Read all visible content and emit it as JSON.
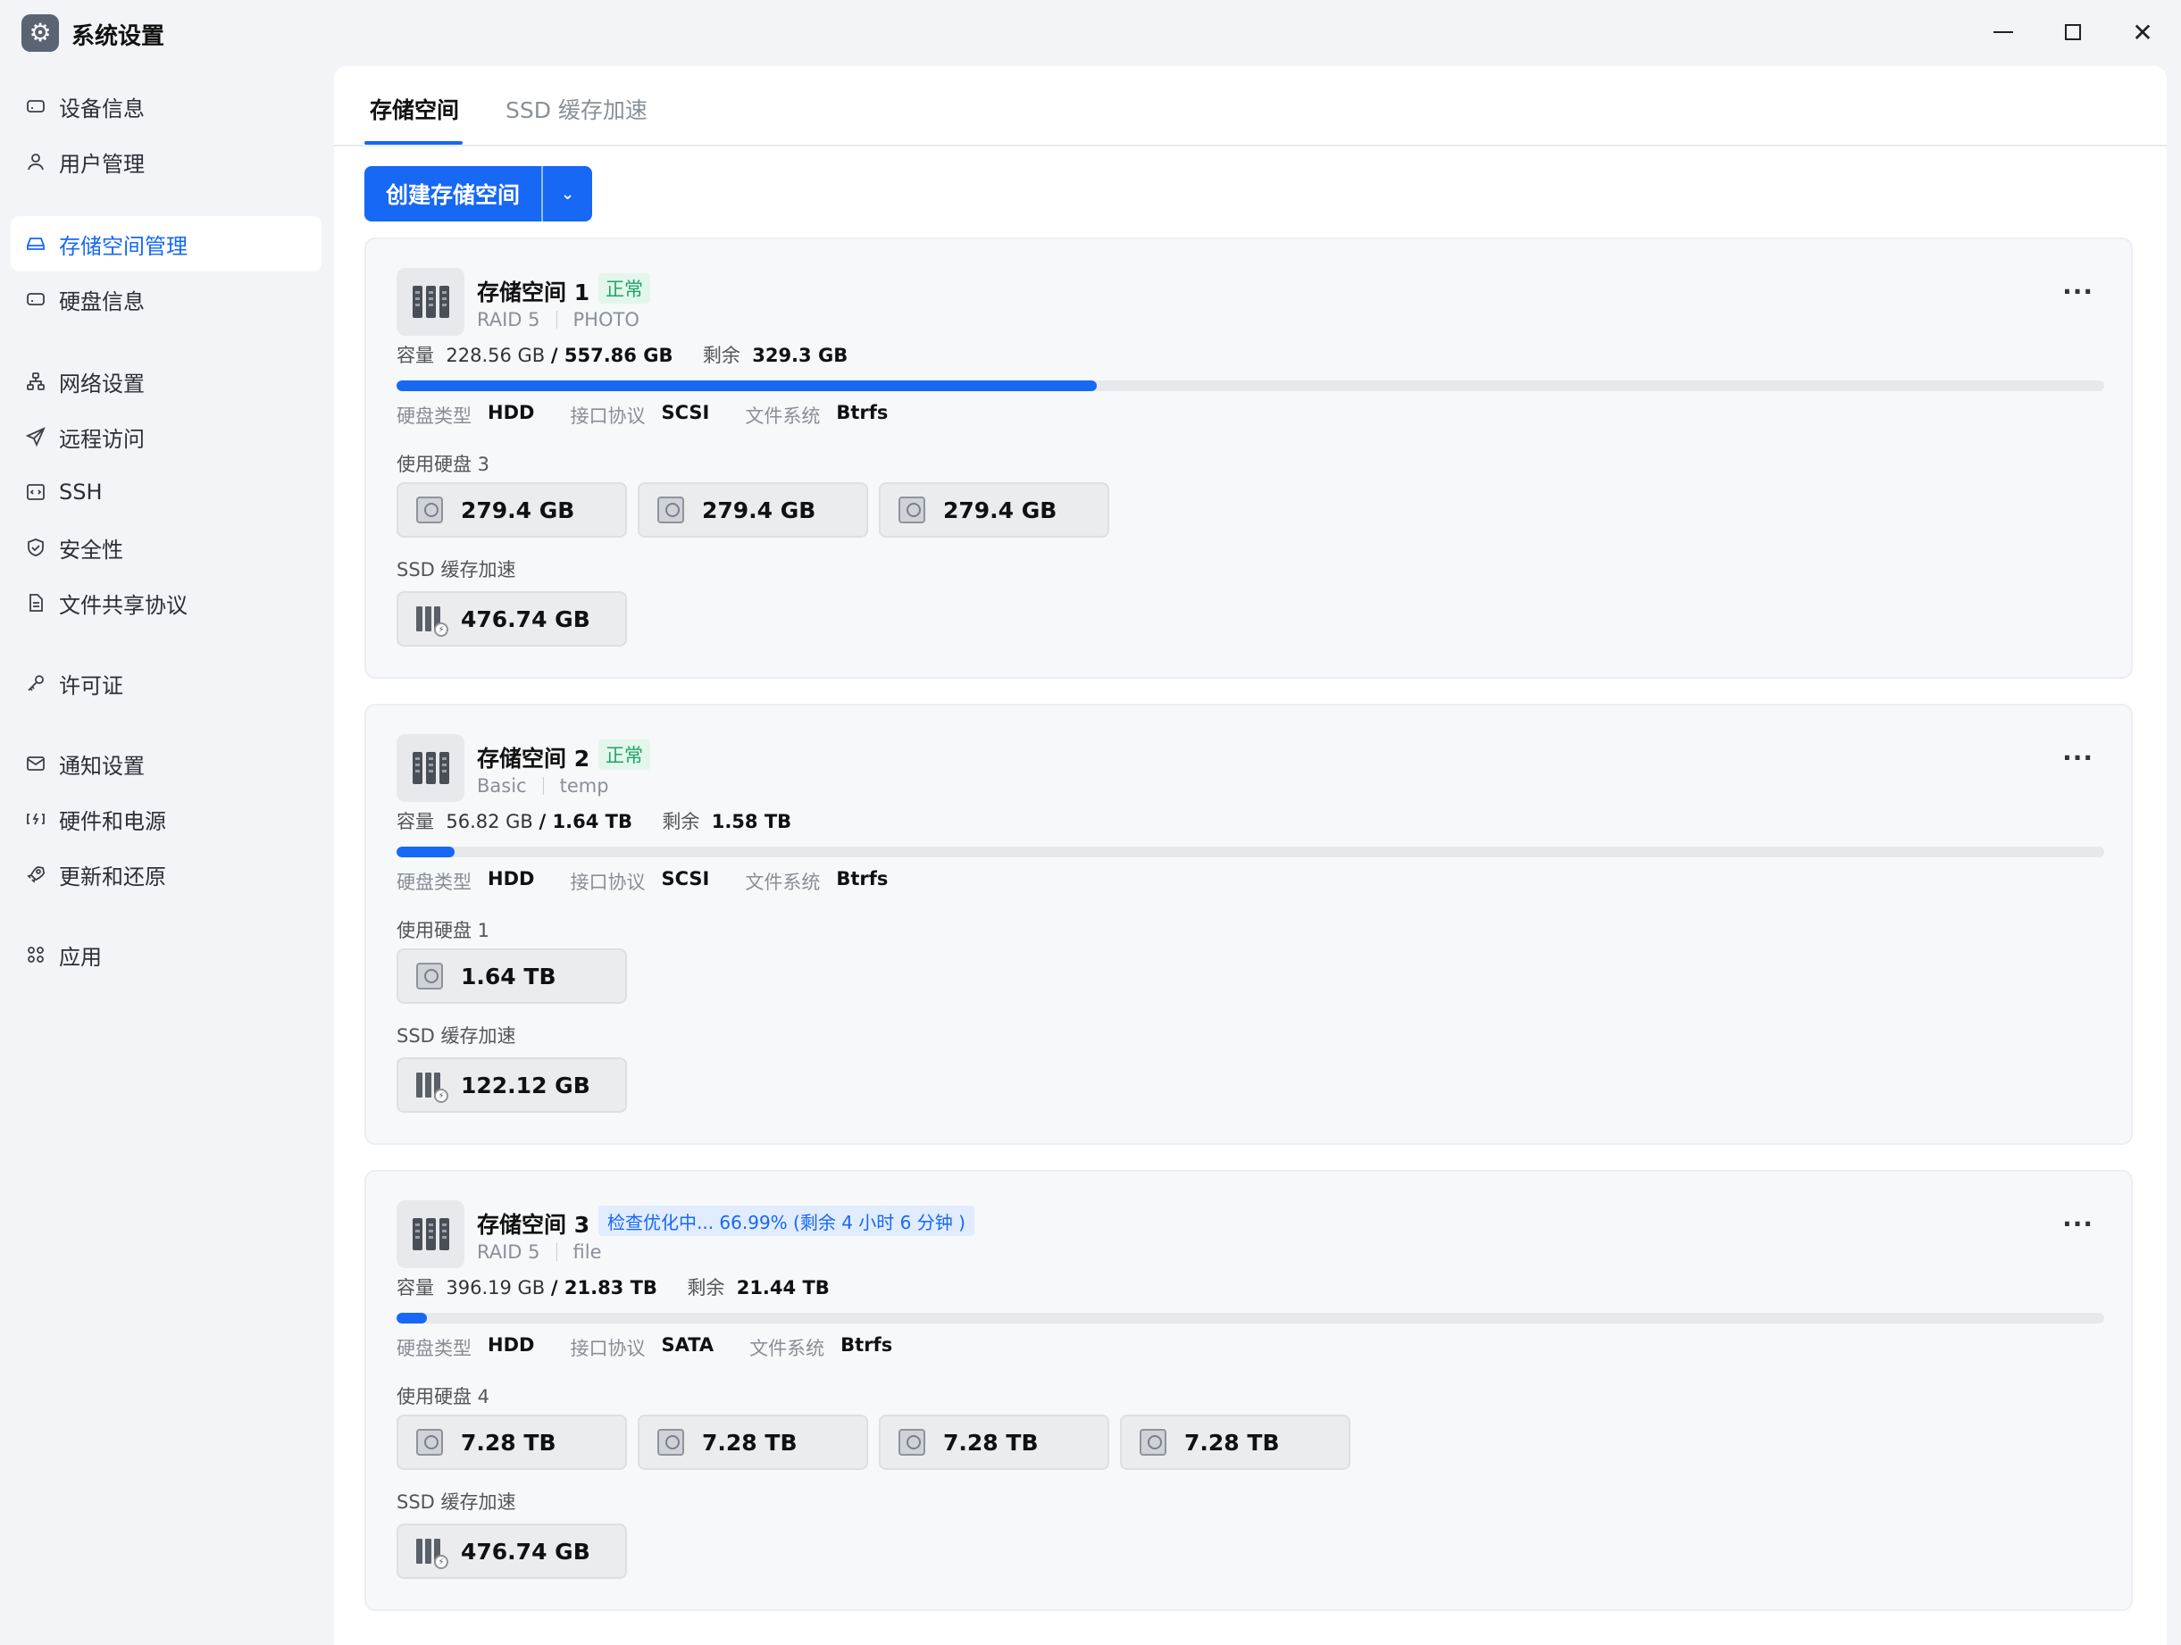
{
  "window": {
    "title": "系统设置",
    "minimize_icon": "minimize-icon",
    "maximize_icon": "maximize-icon",
    "close_glyph": "✕"
  },
  "sidebar": {
    "items": [
      {
        "label": "设备信息",
        "icon": "drive-icon"
      },
      {
        "label": "用户管理",
        "icon": "user-icon"
      },
      {
        "label": "存储空间管理",
        "icon": "storage-icon",
        "active": true
      },
      {
        "label": "硬盘信息",
        "icon": "disk-icon"
      },
      {
        "label": "网络设置",
        "icon": "network-icon"
      },
      {
        "label": "远程访问",
        "icon": "send-icon"
      },
      {
        "label": "SSH",
        "icon": "terminal-icon"
      },
      {
        "label": "安全性",
        "icon": "shield-icon"
      },
      {
        "label": "文件共享协议",
        "icon": "document-icon"
      },
      {
        "label": "许可证",
        "icon": "key-icon"
      },
      {
        "label": "通知设置",
        "icon": "mail-icon"
      },
      {
        "label": "硬件和电源",
        "icon": "power-icon"
      },
      {
        "label": "更新和还原",
        "icon": "rocket-icon"
      },
      {
        "label": "应用",
        "icon": "apps-icon"
      }
    ]
  },
  "tabs": [
    {
      "label": "存储空间",
      "active": true
    },
    {
      "label": "SSD 缓存加速",
      "active": false
    }
  ],
  "create_button": {
    "label": "创建存储空间",
    "dropdown_glyph": "⌄"
  },
  "labels": {
    "capacity": "容量",
    "remaining": "剩余",
    "disk_type": "硬盘类型",
    "interface": "接口协议",
    "filesystem": "文件系统",
    "ssd_cache": "SSD 缓存加速",
    "more": "···"
  },
  "pools": [
    {
      "name": "存储空间 1",
      "status": "正常",
      "status_kind": "ok",
      "raid": "RAID 5",
      "volume": "PHOTO",
      "used": "228.56 GB",
      "total": "/ 557.86 GB",
      "free": "329.3 GB",
      "usage_fraction": 0.41,
      "disk_type": "HDD",
      "interface": "SCSI",
      "filesystem": "Btrfs",
      "disks_label": "使用硬盘 3",
      "disks": [
        "279.4 GB",
        "279.4 GB",
        "279.4 GB"
      ],
      "ssd": "476.74 GB"
    },
    {
      "name": "存储空间 2",
      "status": "正常",
      "status_kind": "ok",
      "raid": "Basic",
      "volume": "temp",
      "used": "56.82 GB",
      "total": "/ 1.64 TB",
      "free": "1.58 TB",
      "usage_fraction": 0.034,
      "disk_type": "HDD",
      "interface": "SCSI",
      "filesystem": "Btrfs",
      "disks_label": "使用硬盘 1",
      "disks": [
        "1.64 TB"
      ],
      "ssd": "122.12 GB"
    },
    {
      "name": "存储空间 3",
      "status": "检查优化中... 66.99% (剩余 4 小时 6 分钟 )",
      "status_kind": "checking",
      "raid": "RAID 5",
      "volume": "file",
      "used": "396.19 GB",
      "total": "/ 21.83 TB",
      "free": "21.44 TB",
      "usage_fraction": 0.018,
      "disk_type": "HDD",
      "interface": "SATA",
      "filesystem": "Btrfs",
      "disks_label": "使用硬盘 4",
      "disks": [
        "7.28 TB",
        "7.28 TB",
        "7.28 TB",
        "7.28 TB"
      ],
      "ssd": "476.74 GB"
    }
  ],
  "colors": {
    "accent": "#1668f5",
    "ok": "#21a366",
    "ok_bg": "#e3f6ec"
  }
}
